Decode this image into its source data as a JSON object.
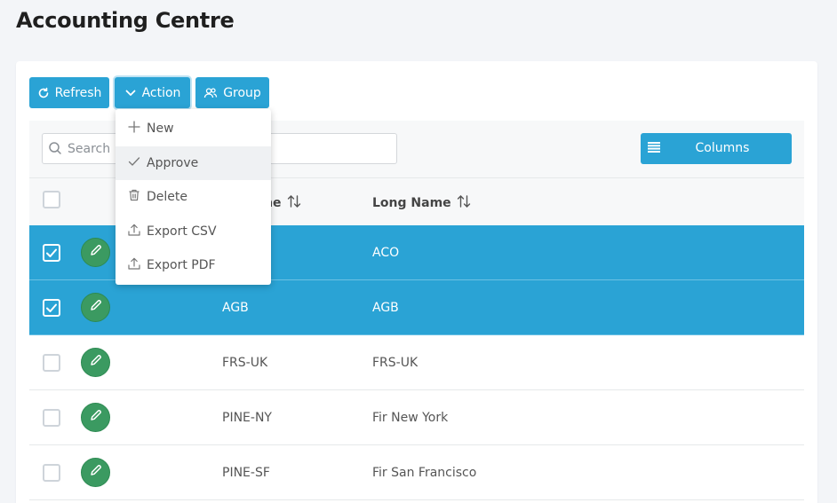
{
  "page": {
    "title": "Accounting Centre"
  },
  "toolbar": {
    "refresh_label": "Refresh",
    "action_label": "Action",
    "group_label": "Group"
  },
  "action_menu": {
    "items": [
      {
        "label": "New",
        "icon": "plus-icon"
      },
      {
        "label": "Approve",
        "icon": "check-icon"
      },
      {
        "label": "Delete",
        "icon": "trash-icon"
      },
      {
        "label": "Export CSV",
        "icon": "upload-icon"
      },
      {
        "label": "Export PDF",
        "icon": "upload-icon"
      }
    ],
    "highlighted": "Approve"
  },
  "search": {
    "placeholder": "Search",
    "value": ""
  },
  "columns_button": {
    "label": "Columns"
  },
  "table": {
    "columns": [
      {
        "label": "Short Name",
        "visible_label": "ame",
        "sortable": true
      },
      {
        "label": "Long Name",
        "visible_label": "Long Name",
        "sortable": true
      }
    ],
    "rows": [
      {
        "short": "",
        "long": "ACO",
        "selected": true
      },
      {
        "short": "AGB",
        "long": "AGB",
        "selected": true
      },
      {
        "short": "FRS-UK",
        "long": "FRS-UK",
        "selected": false
      },
      {
        "short": "PINE-NY",
        "long": "Fir New York",
        "selected": false
      },
      {
        "short": "PINE-SF",
        "long": "Fir San Francisco",
        "selected": false
      }
    ]
  },
  "colors": {
    "accent": "#2aa3d5",
    "edit_button": "#3b9a61",
    "selected_row": "#2aa3d5"
  }
}
